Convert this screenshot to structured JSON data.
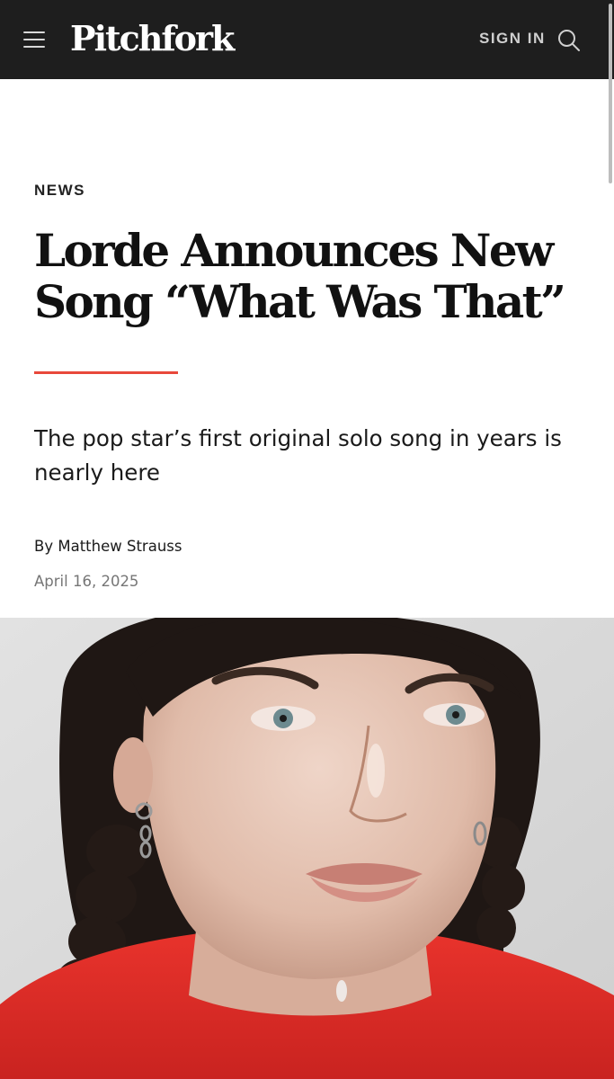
{
  "header": {
    "logo": "Pitchfork",
    "menu_icon": "hamburger-menu-icon",
    "signin_label": "SIGN IN",
    "search_icon": "search-icon",
    "background_color": "#1e1e1e"
  },
  "article": {
    "section": "NEWS",
    "headline": "Lorde Announces New Song “What Was That”",
    "accent_color": "#e8483b",
    "dek": "The pop star’s first original solo song in years is nearly here",
    "byline_prefix": "By ",
    "author": "Matthew Strauss",
    "date": "April 16, 2025"
  },
  "lead_image": {
    "alt": "Lorde portrait photo"
  }
}
